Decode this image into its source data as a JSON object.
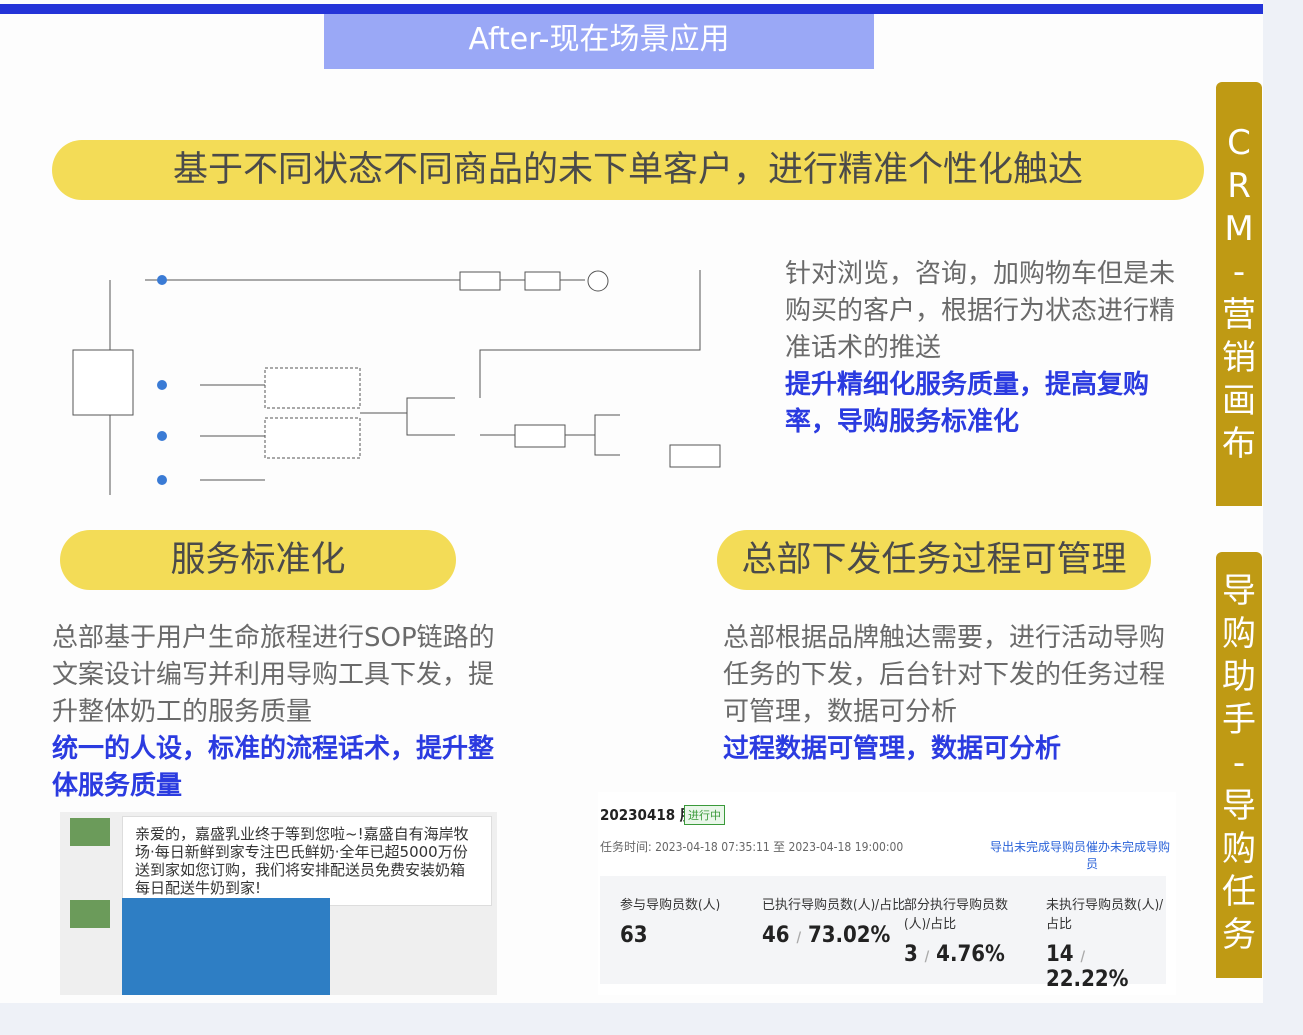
{
  "header": {
    "tab_title": "After-现在场景应用"
  },
  "main_banner": "基于不同状态不同商品的未下单客户，进行精准个性化触达",
  "section_browse": {
    "text": "针对浏览，咨询，加购物车但是未购买的客户，根据行为状态进行精准话术的推送",
    "highlight": "提升精细化服务质量，提高复购率，导购服务标准化"
  },
  "section_service": {
    "banner": "服务标准化",
    "text": "总部基于用户生命旅程进行SOP链路的文案设计编写并利用导购工具下发，提升整体奶工的服务质量",
    "highlight": "统一的人设，标准的流程话术，提升整体服务质量"
  },
  "section_hq": {
    "banner": "总部下发任务过程可管理",
    "text": "总部根据品牌触达需要，进行活动导购任务的下发，后台针对下发的任务过程可管理，数据可分析",
    "highlight": "过程数据可管理，数据可分析"
  },
  "chat": {
    "message": "亲爱的，嘉盛乳业终于等到您啦~!嘉盛自有海岸牧场·每日新鲜到家专注巴氏鲜奶·全年已超5000万份送到家如您订购，我们将安排配送员免费安装奶箱每日配送牛奶到家!"
  },
  "task_panel": {
    "title": "20230418 朋友圈",
    "status": "进行中",
    "time": "任务时间: 2023-04-18 07:35:11 至 2023-04-18 19:00:00",
    "link_export": "导出未完成导购员",
    "link_remind": "催办未完成导购员",
    "stats": [
      {
        "label": "参与导购员数(人)",
        "count": "63",
        "pct": ""
      },
      {
        "label": "已执行导购员数(人)/占比",
        "count": "46",
        "pct": "73.02%"
      },
      {
        "label": "部分执行导购员数(人)/占比",
        "count": "3",
        "pct": "4.76%"
      },
      {
        "label": "未执行导购员数(人)/占比",
        "count": "14",
        "pct": "22.22%"
      }
    ]
  },
  "sidebar": {
    "crm_chars": [
      "C",
      "R",
      "M",
      "-",
      "营",
      "销",
      "画",
      "布"
    ],
    "guide_chars": [
      "导",
      "购",
      "助",
      "手",
      "-",
      "导",
      "购",
      "任",
      "务"
    ]
  }
}
